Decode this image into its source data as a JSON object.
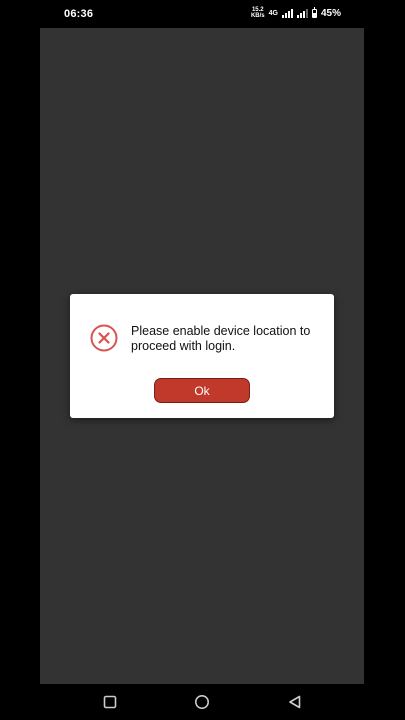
{
  "status_bar": {
    "time": "06:36",
    "net_speed_value": "15.2",
    "net_speed_unit": "KB/s",
    "network_type": "4G",
    "battery_percent": "45%",
    "battery_level": 0.45
  },
  "dialog": {
    "icon": "error-x-circle-icon",
    "message": "Please enable device location to proceed with login.",
    "ok_label": "Ok",
    "accent_color": "#c0392b"
  },
  "nav_bar": {
    "icons": [
      "recent-apps-icon",
      "home-icon",
      "back-icon"
    ]
  }
}
